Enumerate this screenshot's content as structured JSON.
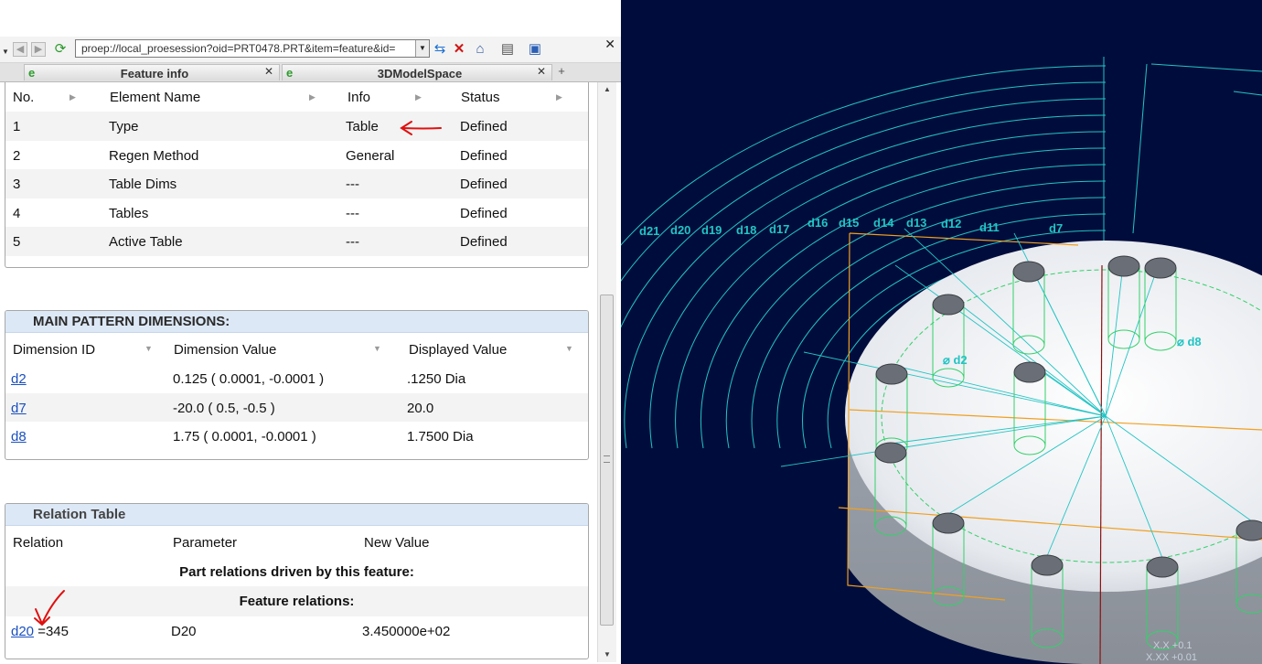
{
  "browser": {
    "url": "proep://local_proesession?oid=PRT0478.PRT&item=feature&id=",
    "tabs": [
      {
        "label": "Feature info"
      },
      {
        "label": "3DModelSpace"
      }
    ],
    "close_symbol": "✕",
    "add_tab_symbol": "+",
    "icons": [
      "back-arrow-icon",
      "forward-arrow-icon",
      "refresh-icon",
      "url-dropdown-icon",
      "sync-icon",
      "stop-icon",
      "home-icon",
      "print-icon",
      "save-icon",
      "close-icon"
    ]
  },
  "feature_table": {
    "columns": [
      "No.",
      "Element Name",
      "Info",
      "Status"
    ],
    "rows": [
      {
        "no": "1",
        "name": "Type",
        "info": "Table",
        "status": "Defined"
      },
      {
        "no": "2",
        "name": "Regen Method",
        "info": "General",
        "status": "Defined"
      },
      {
        "no": "3",
        "name": "Table Dims",
        "info": "---",
        "status": "Defined"
      },
      {
        "no": "4",
        "name": "Tables",
        "info": "---",
        "status": "Defined"
      },
      {
        "no": "5",
        "name": "Active Table",
        "info": "---",
        "status": "Defined"
      }
    ]
  },
  "dimensions": {
    "title": "MAIN PATTERN DIMENSIONS:",
    "columns": [
      "Dimension ID",
      "Dimension Value",
      "Displayed Value"
    ],
    "rows": [
      {
        "id": "d2",
        "value": "0.125 ( 0.0001, -0.0001 )",
        "display": ".1250 Dia"
      },
      {
        "id": "d7",
        "value": "-20.0 ( 0.5, -0.5 )",
        "display": "20.0"
      },
      {
        "id": "d8",
        "value": "1.75 ( 0.0001, -0.0001 )",
        "display": "1.7500 Dia"
      }
    ]
  },
  "relations": {
    "title": "Relation Table",
    "columns": [
      "Relation",
      "Parameter",
      "New Value"
    ],
    "part_relations_label": "Part relations driven by this feature:",
    "feature_relations_label": "Feature relations:",
    "row": {
      "id": "d20",
      "expr": "=345",
      "param": "D20",
      "value": "3.450000e+02"
    }
  },
  "model_view": {
    "dim_labels": [
      "d21",
      "d20",
      "d19",
      "d18",
      "d17",
      "d16",
      "d15",
      "d14",
      "d13",
      "d12",
      "d11",
      "d7"
    ],
    "dia_labels": [
      "⌀ d2",
      "⌀ d8"
    ],
    "coord_lines": [
      "X.X +0.1",
      "X.XX +0.01"
    ],
    "colors": {
      "background": "#000d3c",
      "dimension": "#22c4c4",
      "hole": "#33d16a",
      "bbox": "#f0a020",
      "annotation": "#e01010"
    }
  }
}
